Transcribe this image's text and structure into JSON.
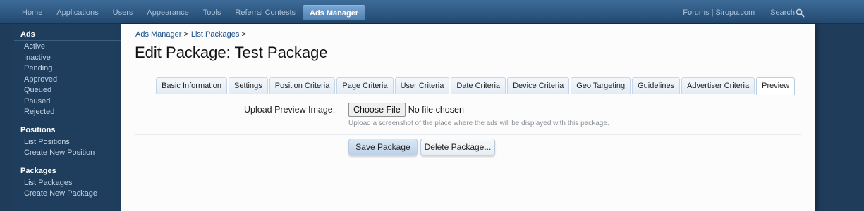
{
  "topnav": {
    "tabs": [
      {
        "label": "Home"
      },
      {
        "label": "Applications"
      },
      {
        "label": "Users"
      },
      {
        "label": "Appearance"
      },
      {
        "label": "Tools"
      },
      {
        "label": "Referral Contests"
      },
      {
        "label": "Ads Manager",
        "active": true
      }
    ],
    "right_links": {
      "forums": "Forums | Siropu.com",
      "search": "Search"
    }
  },
  "sidebar": {
    "groups": [
      {
        "heading": "Ads",
        "items": [
          "Active",
          "Inactive",
          "Pending",
          "Approved",
          "Queued",
          "Paused",
          "Rejected"
        ]
      },
      {
        "heading": "Positions",
        "items": [
          "List Positions",
          "Create New Position"
        ]
      },
      {
        "heading": "Packages",
        "items": [
          "List Packages",
          "Create New Package"
        ]
      }
    ]
  },
  "breadcrumb": {
    "items": [
      "Ads Manager",
      "List Packages"
    ],
    "separator": ">"
  },
  "page": {
    "title": "Edit Package: Test Package"
  },
  "tabs": [
    "Basic Information",
    "Settings",
    "Position Criteria",
    "Page Criteria",
    "User Criteria",
    "Date Criteria",
    "Device Criteria",
    "Geo Targeting",
    "Guidelines",
    "Advertiser Criteria",
    "Preview"
  ],
  "selected_tab": "Preview",
  "form": {
    "label": "Upload Preview Image:",
    "choose_file": "Choose File",
    "file_status": "No file chosen",
    "hint": "Upload a screenshot of the place where the ads will be displayed with this package."
  },
  "buttons": {
    "save": "Save Package",
    "delete": "Delete Package..."
  },
  "colors": {
    "nav_bg": "#2b5580",
    "sidebar_bg": "#1f3e5e",
    "accent": "#1c4f83"
  }
}
